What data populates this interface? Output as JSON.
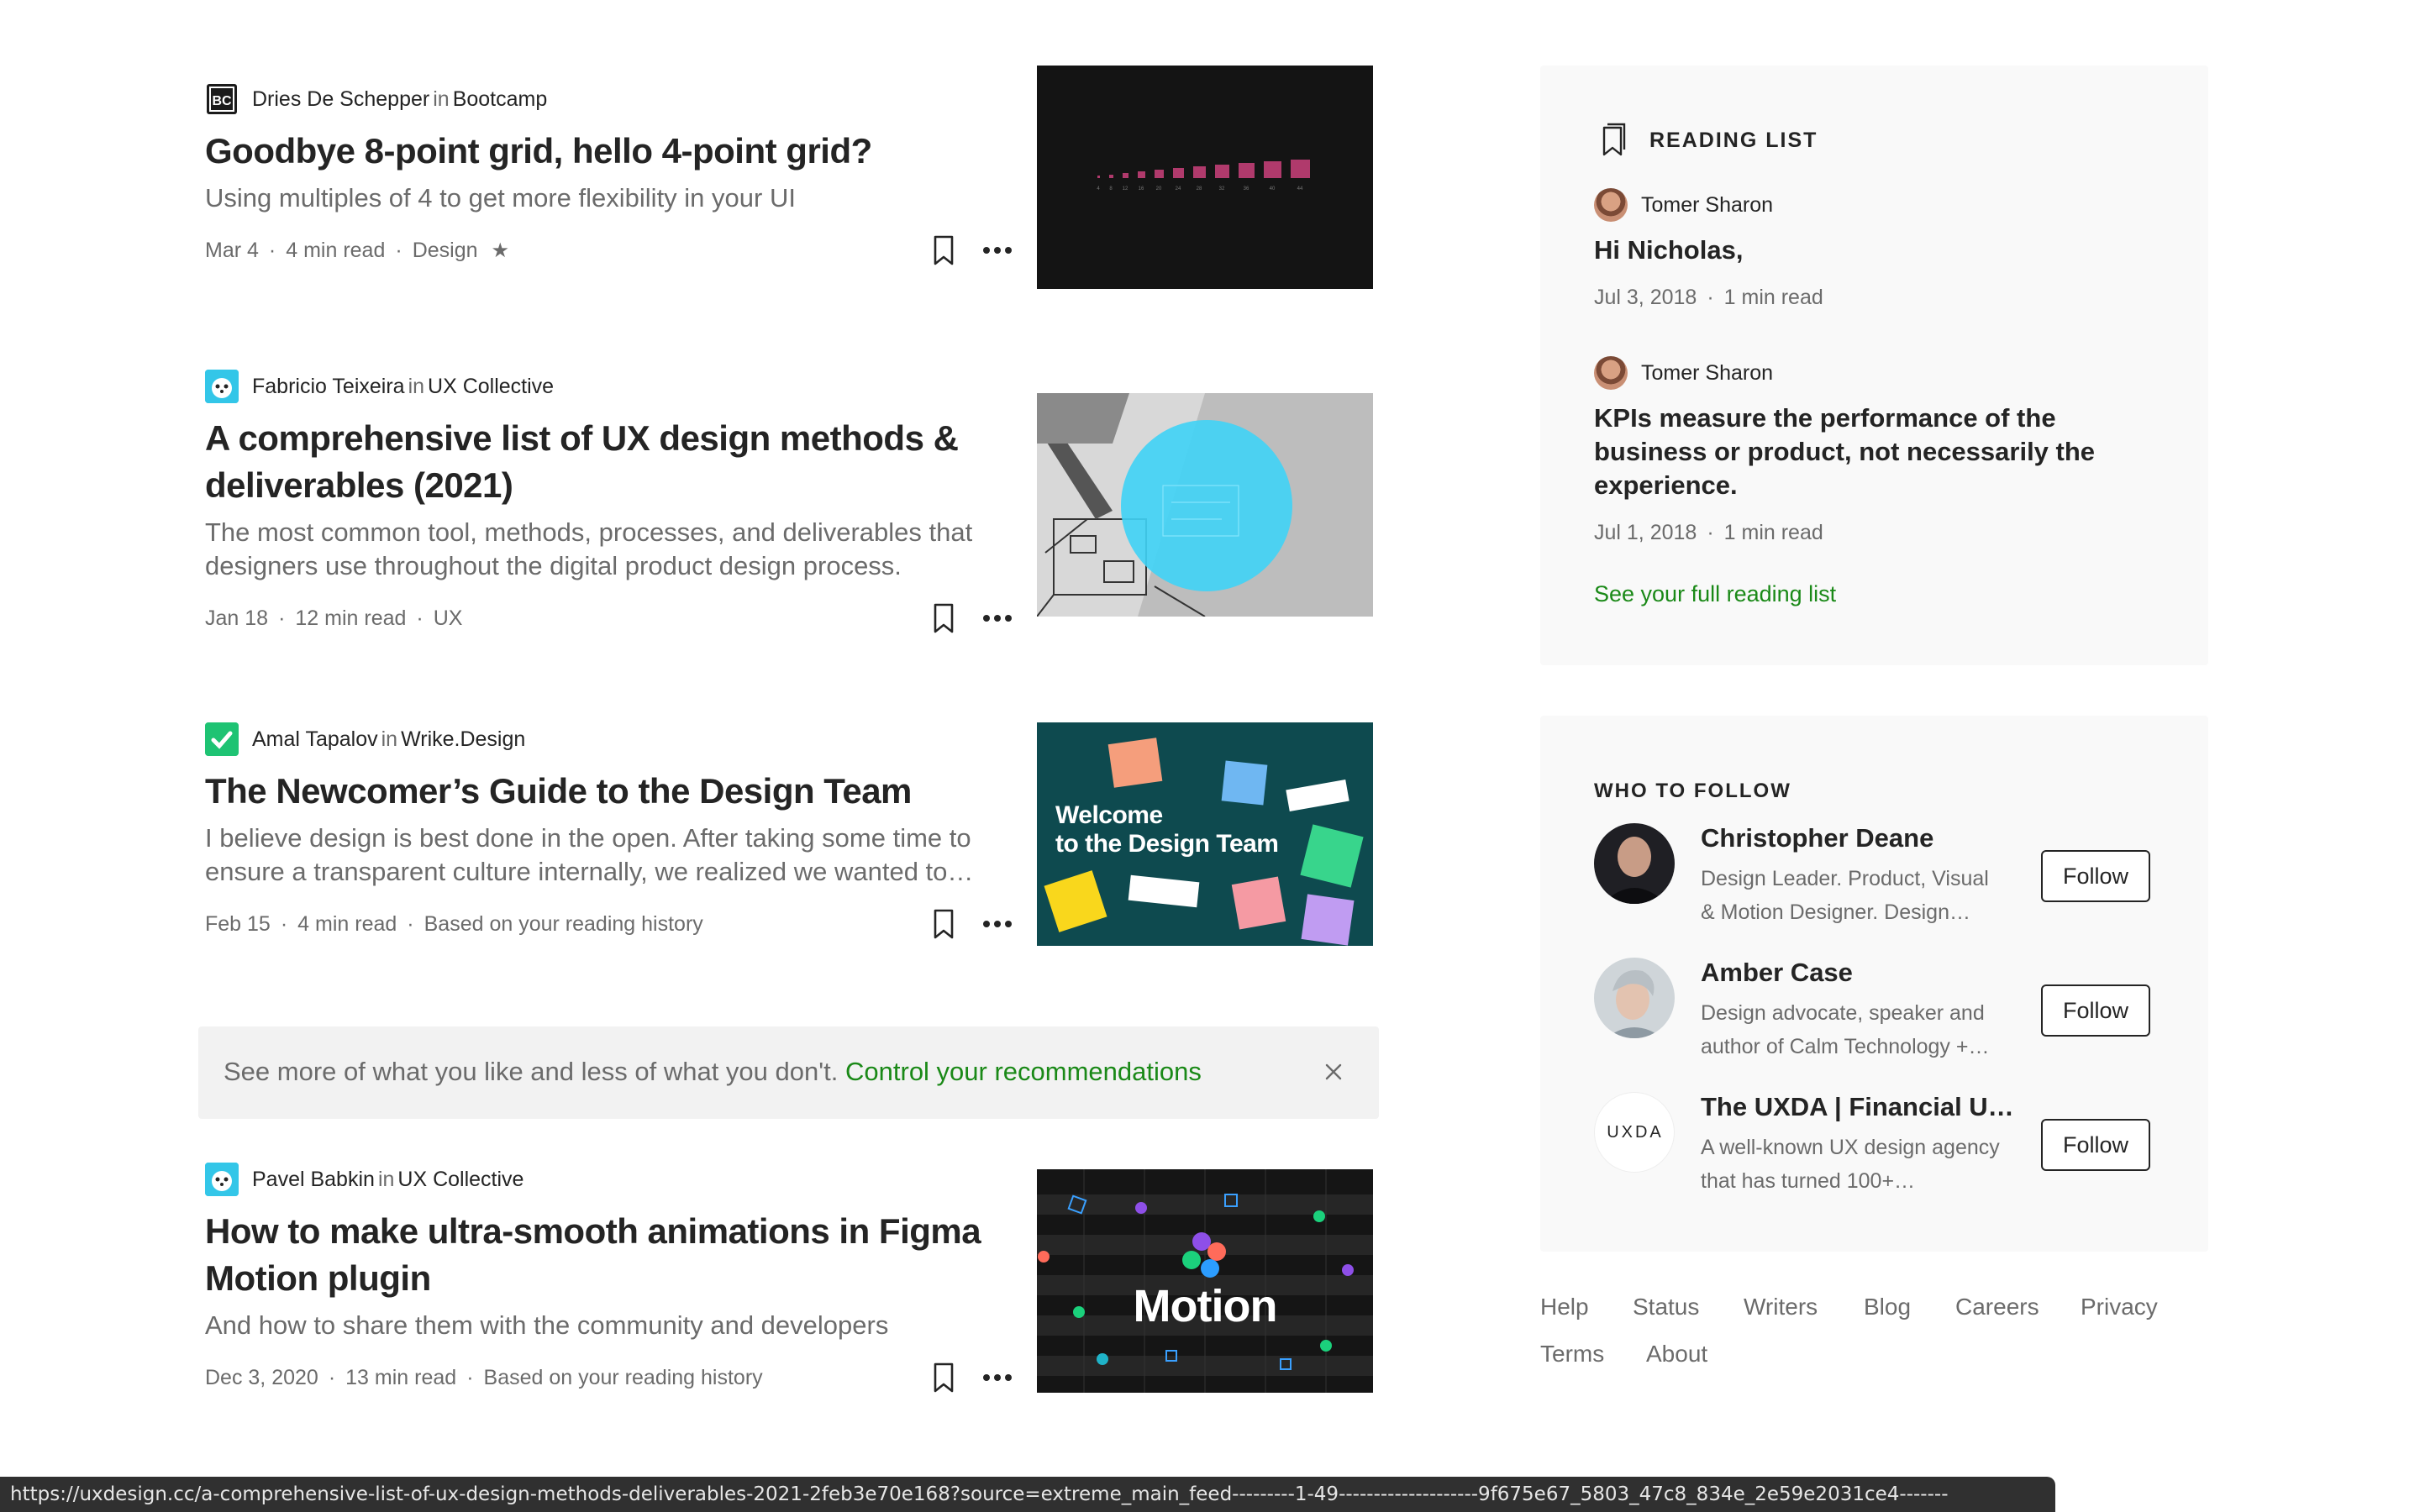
{
  "feed": {
    "articles": [
      {
        "author": "Dries De Schepper",
        "in": "in",
        "publication": "Bootcamp",
        "title": "Goodbye 8-point grid, hello 4-point grid?",
        "subtitle": "Using multiples of 4 to get more flexibility in your UI",
        "date": "Mar 4",
        "read_time": "4 min read",
        "tag": "Design",
        "member_star": "★",
        "thumb_icon": "bar-grid-thumbnail"
      },
      {
        "author": "Fabricio Teixeira",
        "in": "in",
        "publication": "UX Collective",
        "title": "A comprehensive list of UX design methods & deliverables (2021)",
        "subtitle": "The most common tool, methods, processes, and deliverables that designers use throughout the digital product design process.",
        "date": "Jan 18",
        "read_time": "12 min read",
        "tag": "UX",
        "thumb_icon": "sketch-wireframe-thumbnail"
      },
      {
        "author": "Amal Tapalov",
        "in": "in",
        "publication": "Wrike.Design",
        "title": "The Newcomer’s Guide to the Design Team",
        "subtitle": "I believe design is best done in the open. After taking some time to ensure a transparent culture internally, we realized we wanted to…",
        "date": "Feb 15",
        "read_time": "4 min read",
        "tag": "Based on your reading history",
        "thumb_text": [
          "Welcome",
          "to the Design Team"
        ]
      },
      {
        "author": "Pavel Babkin",
        "in": "in",
        "publication": "UX Collective",
        "title": "How to make ultra-smooth animations in Figma Motion plugin",
        "subtitle": "And how to share them with the community and developers",
        "date": "Dec 3, 2020",
        "read_time": "13 min read",
        "tag": "Based on your reading history",
        "thumb_text": "Motion"
      }
    ],
    "recommendation_bar": {
      "text": "See more of what you like and less of what you don't. ",
      "link": "Control your recommendations"
    }
  },
  "sidebar": {
    "reading_list": {
      "heading": "READING LIST",
      "items": [
        {
          "author": "Tomer Sharon",
          "title": "Hi Nicholas,",
          "date": "Jul 3, 2018",
          "read_time": "1 min read"
        },
        {
          "author": "Tomer Sharon",
          "title": "KPIs measure the performance of the business or product, not necessarily the experience.",
          "date": "Jul 1, 2018",
          "read_time": "1 min read"
        }
      ],
      "link": "See your full reading list"
    },
    "who_to_follow": {
      "heading": "WHO TO FOLLOW",
      "button_label": "Follow",
      "people": [
        {
          "name": "Christopher Deane",
          "desc": "Design Leader. Product, Visual & Motion Designer. Design…"
        },
        {
          "name": "Amber Case",
          "desc": "Design advocate, speaker and author of Calm Technology +…"
        },
        {
          "name": "The UXDA | Financial U…",
          "desc": "A well-known UX design agency that has turned 100+…",
          "logo_text": "UXDA"
        }
      ]
    },
    "footer_links": [
      "Help",
      "Status",
      "Writers",
      "Blog",
      "Careers",
      "Privacy",
      "Terms",
      "About"
    ]
  },
  "status_bar": {
    "url": "https://uxdesign.cc/a-comprehensive-list-of-ux-design-methods-deliverables-2021-2feb3e70e168?source=extreme_main_feed---------1-49--------------------9f675e67_5803_47c8_834e_2e59e2031ce4-------"
  },
  "colors": {
    "accent_green": "#1a8917",
    "text": "#242424",
    "muted": "#6b6b6b",
    "panel_bg": "#f9f9f9"
  }
}
